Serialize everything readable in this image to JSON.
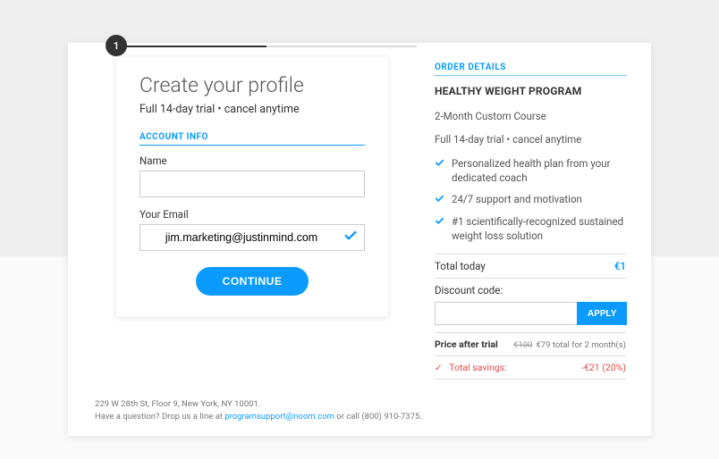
{
  "step": "1",
  "left": {
    "heading": "Create your profile",
    "subtitle": "Full 14-day trial • cancel anytime",
    "section_label": "ACCOUNT INFO",
    "name_label": "Name",
    "name_value": "",
    "email_label": "Your Email",
    "email_value": "jim.marketing@justinmind.com",
    "continue": "CONTINUE"
  },
  "order": {
    "section_label": "ORDER DETAILS",
    "program": "HEALTHY WEIGHT PROGRAM",
    "course": "2-Month Custom Course",
    "trial": "Full 14-day trial • cancel anytime",
    "features": [
      "Personalized health plan from your dedicated coach",
      "24/7 support and motivation",
      "#1 scientifically-recognized sustained weight loss solution"
    ],
    "total_label": "Total today",
    "total_value": "€1",
    "discount_label": "Discount code:",
    "apply": "APPLY",
    "price_after_label": "Price after trial",
    "price_strike": "€100",
    "price_detail": "€79 total for 2 month(s)",
    "savings_label": "Total savings:",
    "savings_value": "-€21 (20%)"
  },
  "footer": {
    "address": "229 W 28th St, Floor 9, New York, NY 10001.",
    "question_prefix": "Have a question? Drop us a line at ",
    "email": "programsupport@noom.com",
    "question_suffix": " or call (800) 910-7375."
  }
}
